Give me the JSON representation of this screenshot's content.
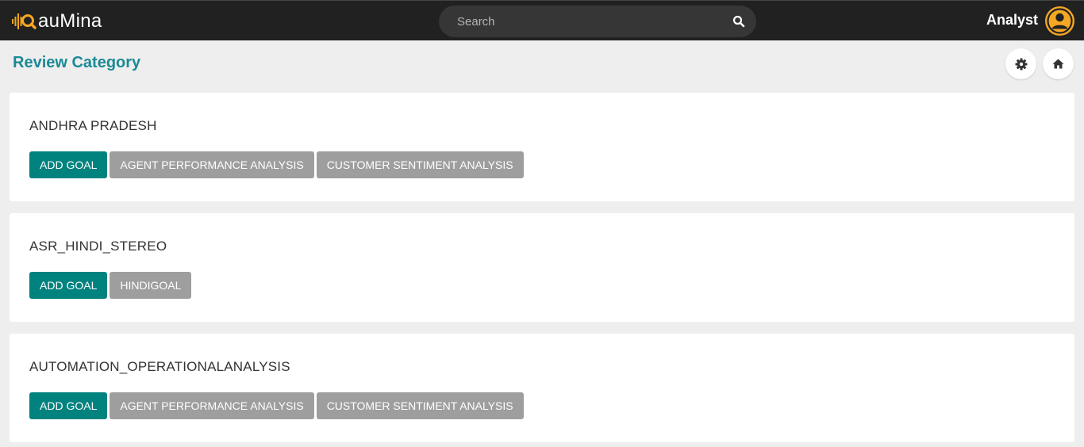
{
  "header": {
    "logo_text": "auMina",
    "search_placeholder": "Search",
    "user_name": "Analyst"
  },
  "page": {
    "title": "Review Category"
  },
  "categories": [
    {
      "name": "ANDHRA PRADESH",
      "add_label": "ADD GOAL",
      "goals": [
        "AGENT PERFORMANCE ANALYSIS",
        "CUSTOMER SENTIMENT ANALYSIS"
      ]
    },
    {
      "name": "ASR_HINDI_STEREO",
      "add_label": "ADD GOAL",
      "goals": [
        "HINDIGOAL"
      ]
    },
    {
      "name": "AUTOMATION_OPERATIONALANALYSIS",
      "add_label": "ADD GOAL",
      "goals": [
        "AGENT PERFORMANCE ANALYSIS",
        "CUSTOMER SENTIMENT ANALYSIS"
      ]
    }
  ],
  "colors": {
    "accent": "#1b8a96",
    "primary_button": "#00827f",
    "secondary_button": "#9e9e9e",
    "logo_gold": "#f5a623",
    "header_bg": "#212121"
  },
  "icons": {
    "logo": "sound-wave-magnifier-icon",
    "search": "search-icon",
    "avatar": "user-circle-icon",
    "settings": "gear-icon",
    "home": "home-icon"
  }
}
